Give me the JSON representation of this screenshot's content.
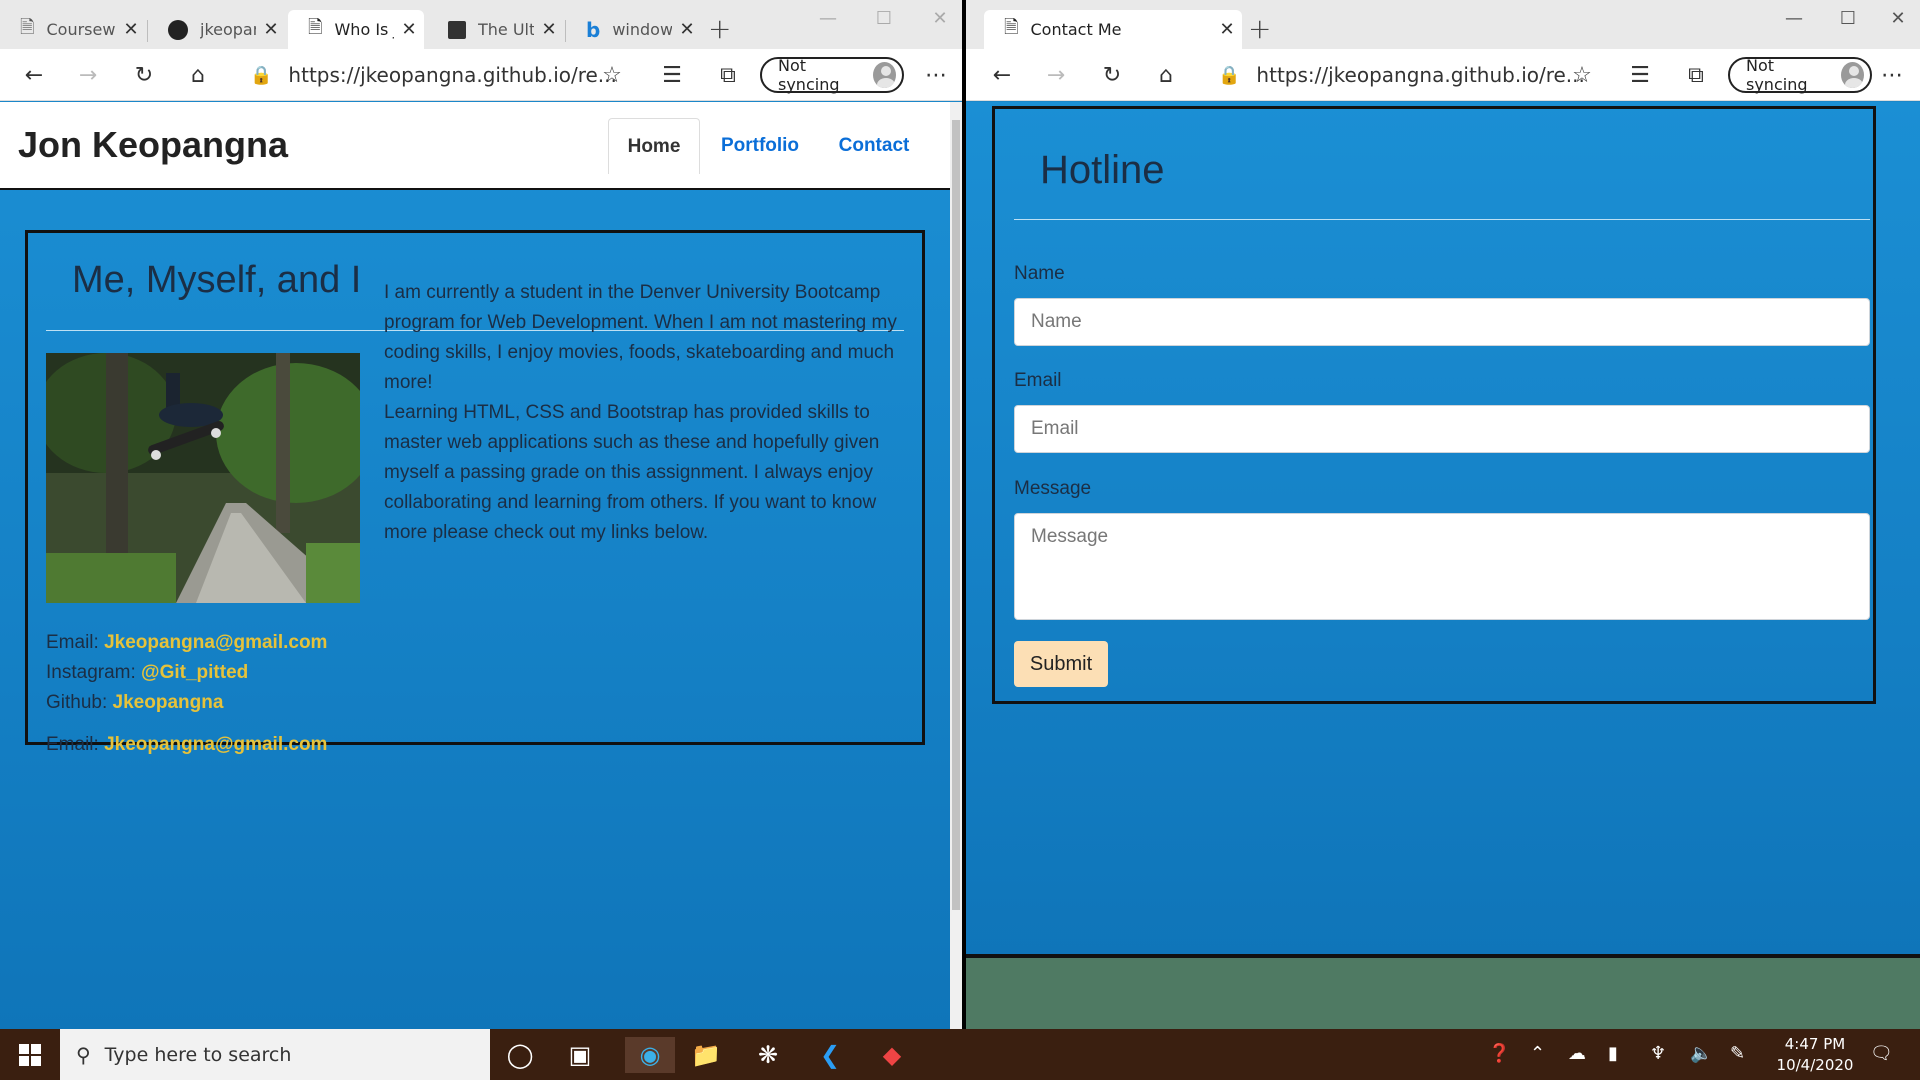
{
  "left_window": {
    "tabs": [
      {
        "title": "Coursew",
        "icon": "page-icon"
      },
      {
        "title": "jkeopan",
        "icon": "github-icon"
      },
      {
        "title": "Who Is J",
        "icon": "page-icon",
        "active": true
      },
      {
        "title": "The Ulti",
        "icon": "notebook-icon"
      },
      {
        "title": "window",
        "icon": "bing-icon"
      }
    ],
    "url": "https://jkeopangna.github.io/re...",
    "sync_label": "Not syncing",
    "site": {
      "brand": "Jon Keopangna",
      "nav": [
        "Home",
        "Portfolio",
        "Contact"
      ],
      "card_title": "Me, Myself, and I",
      "bio": "I am currently a student in the Denver University Bootcamp program for Web Development. When I am not mastering my coding skills, I enjoy movies, foods, skateboarding and much more!",
      "bio2": "Learning HTML, CSS and Bootstrap has provided skills to master web applications such as these and hopefully given myself a passing grade on this assignment. I always enjoy collaborating and learning from others. If you want to know more please check out my links below.",
      "contacts": [
        {
          "label": "Email:",
          "value": "Jkeopangna@gmail.com"
        },
        {
          "label": "Instagram:",
          "value": "@Git_pitted"
        },
        {
          "label": "Github:",
          "value": "Jkeopangna"
        }
      ]
    }
  },
  "right_window": {
    "tab_title": "Contact Me",
    "url": "https://jkeopangna.github.io/re...",
    "sync_label": "Not syncing",
    "form": {
      "title": "Hotline",
      "name_label": "Name",
      "name_placeholder": "Name",
      "email_label": "Email",
      "email_placeholder": "Email",
      "message_label": "Message",
      "message_placeholder": "Message",
      "submit_label": "Submit"
    }
  },
  "taskbar": {
    "search_placeholder": "Type here to search",
    "time": "4:47 PM",
    "date": "10/4/2020"
  },
  "colors": {
    "page_blue": "#1b87c9",
    "link_gold": "#e6c23a",
    "nav_blue": "#0a6ed8",
    "submit_bg": "#fcdfb5",
    "taskbar": "#3a1f10"
  }
}
